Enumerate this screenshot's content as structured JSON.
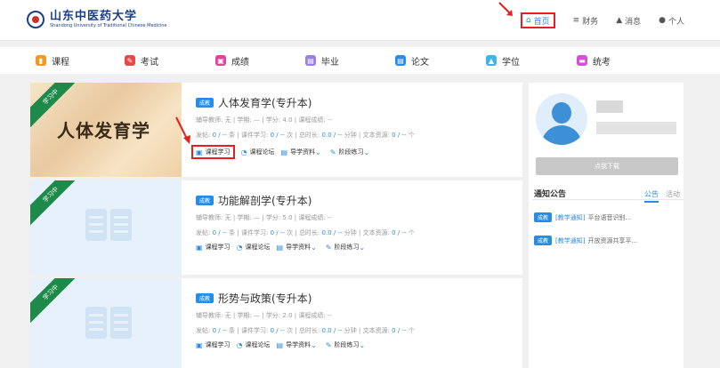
{
  "header": {
    "logo_cn": "山东中医药大学",
    "logo_en": "Shandong University of Traditional Chinese Medicine",
    "nav": [
      {
        "label": "首页",
        "icon": "home-icon",
        "glyph": "⌂"
      },
      {
        "label": "财务",
        "icon": "database-icon",
        "glyph": "≡"
      },
      {
        "label": "消息",
        "icon": "bell-icon",
        "glyph": "▲"
      },
      {
        "label": "个人",
        "icon": "user-icon",
        "glyph": "●"
      }
    ]
  },
  "categories": [
    {
      "label": "课程",
      "color": "#f39a1e",
      "glyph": "▮"
    },
    {
      "label": "考试",
      "color": "#e8484a",
      "glyph": "✎"
    },
    {
      "label": "成绩",
      "color": "#e5409a",
      "glyph": "▣"
    },
    {
      "label": "毕业",
      "color": "#9b7fe0",
      "glyph": "▤"
    },
    {
      "label": "论文",
      "color": "#2a8be3",
      "glyph": "▤"
    },
    {
      "label": "学位",
      "color": "#3db6e5",
      "glyph": "▲"
    },
    {
      "label": "统考",
      "color": "#d64fd6",
      "glyph": "▬"
    }
  ],
  "courses": [
    {
      "status": "学习中",
      "thumb_title": "人体发育学",
      "tag": "成教",
      "title": "人体发育学(专升本)",
      "teacher": "辅导教师: 无",
      "hours": "学期: —",
      "credit": "学分: 4.0",
      "score": "课程成绩: --",
      "posts_label": "发帖:",
      "posts": "0 / --",
      "posts_unit": "条",
      "study_label": "课件学习:",
      "study": "0 / --",
      "study_unit": "次",
      "time_label": "总时长:",
      "time": "0.0 / --",
      "time_unit": "分钟",
      "docs_label": "文本资源:",
      "docs": "0 / --",
      "docs_unit": "个"
    },
    {
      "status": "学习中",
      "thumb_title": "",
      "tag": "成教",
      "title": "功能解剖学(专升本)",
      "teacher": "辅导教师: 无",
      "hours": "学期: —",
      "credit": "学分: 5.0",
      "score": "课程成绩: --",
      "posts_label": "发帖:",
      "posts": "0 / --",
      "posts_unit": "条",
      "study_label": "课件学习:",
      "study": "0 / --",
      "study_unit": "次",
      "time_label": "总时长:",
      "time": "0.0 / --",
      "time_unit": "分钟",
      "docs_label": "文本资源:",
      "docs": "0 / --",
      "docs_unit": "个"
    },
    {
      "status": "学习中",
      "thumb_title": "",
      "tag": "成教",
      "title": "形势与政策(专升本)",
      "teacher": "辅导教师: 无",
      "hours": "学期: —",
      "credit": "学分: 2.0",
      "score": "课程成绩: --",
      "posts_label": "发帖:",
      "posts": "0 / --",
      "posts_unit": "条",
      "study_label": "课件学习:",
      "study": "0 / --",
      "study_unit": "次",
      "time_label": "总时长:",
      "time": "0.0 / --",
      "time_unit": "分钟",
      "docs_label": "文本资源:",
      "docs": "0 / --",
      "docs_unit": "个"
    }
  ],
  "actions": {
    "study": "课程学习",
    "forum": "课程论坛",
    "guide": "导学资料",
    "practice": "阶段练习"
  },
  "sidebar": {
    "download_btn": "点我下载",
    "notice_title": "通知公告",
    "tab_notice": "公告",
    "tab_activity": "活动",
    "notices": [
      {
        "tag": "成教",
        "kind": "[教学通知]",
        "text": "平台语音识别..."
      },
      {
        "tag": "成教",
        "kind": "[教学通知]",
        "text": "开放资源共享平..."
      }
    ]
  },
  "colors": {
    "accent": "#2a8be3",
    "highlight": "#e52020",
    "ribbon": "#1e8a4a"
  }
}
